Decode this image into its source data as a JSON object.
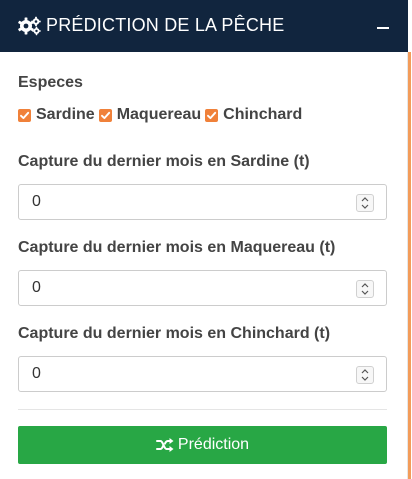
{
  "header": {
    "title": "PRÉDICTION DE LA PÊCHE",
    "icon": "gears-icon",
    "collapse_icon": "minus-icon"
  },
  "species": {
    "label": "Especes",
    "options": [
      {
        "label": "Sardine",
        "checked": true
      },
      {
        "label": "Maquereau",
        "checked": true
      },
      {
        "label": "Chinchard",
        "checked": true
      }
    ]
  },
  "fields": [
    {
      "label": "Capture du dernier mois en Sardine (t)",
      "value": "0"
    },
    {
      "label": "Capture du dernier mois en Maquereau (t)",
      "value": "0"
    },
    {
      "label": "Capture du dernier mois en Chinchard (t)",
      "value": "0"
    }
  ],
  "button": {
    "label": "Prédiction",
    "icon": "shuffle-icon"
  },
  "colors": {
    "header_bg": "#11253e",
    "checkbox": "#f0813a",
    "button_bg": "#28a745",
    "accent_edge": "#f39c5a"
  }
}
